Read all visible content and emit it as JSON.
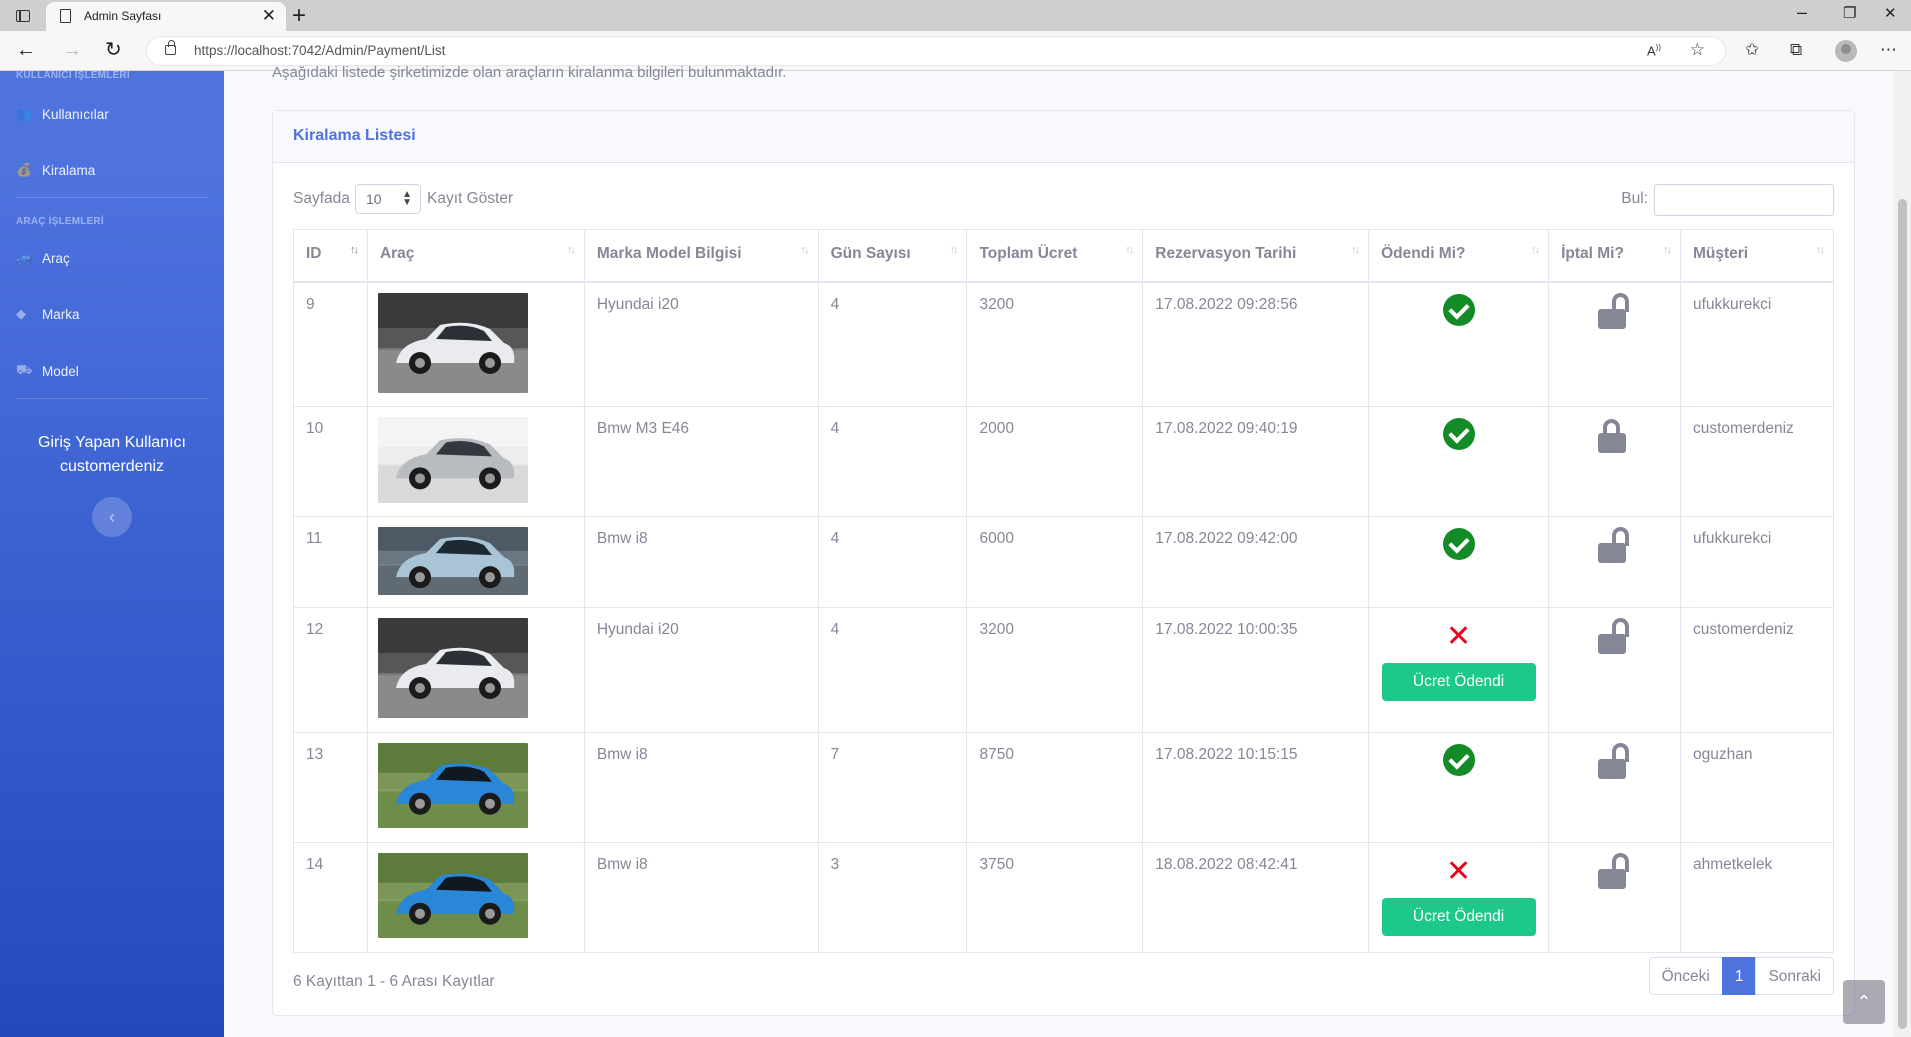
{
  "browser": {
    "tab_title": "Admin Sayfası",
    "url": "https://localhost:7042/Admin/Payment/List",
    "close_glyph": "✕",
    "newtab_glyph": "+"
  },
  "sidebar": {
    "heading_user": "KULLANICI İŞLEMLERİ",
    "heading_vehicle": "ARAÇ İŞLEMLERİ",
    "items": [
      {
        "label": "Kullanıcılar",
        "icon": "users-icon"
      },
      {
        "label": "Kiralama",
        "icon": "money-bag-icon"
      },
      {
        "label": "Araç",
        "icon": "car-icon"
      },
      {
        "label": "Marka",
        "icon": "diamond-icon"
      },
      {
        "label": "Model",
        "icon": "dolly-icon"
      }
    ],
    "user_line1": "Giriş Yapan Kullanıcı",
    "user_line2": "customerdeniz"
  },
  "intro_text": "Aşağıdaki listede şirketimizde olan araçların kiralanma bilgileri bulunmaktadır.",
  "card": {
    "title": "Kiralama Listesi",
    "length_prefix": "Sayfada",
    "length_value": "10",
    "length_suffix": "Kayıt Göster",
    "search_label": "Bul:",
    "columns": [
      "ID",
      "Araç",
      "Marka Model Bilgisi",
      "Gün Sayısı",
      "Toplam Ücret",
      "Rezervasyon Tarihi",
      "Ödendi Mi?",
      "İptal Mi?",
      "Müşteri"
    ],
    "rows": [
      {
        "id": "9",
        "car": "hyundai-white",
        "model": "Hyundai i20",
        "days": "4",
        "total": "3200",
        "date": "17.08.2022 09:28:56",
        "paid": true,
        "cancel_locked": false,
        "customer": "ufukkurekci"
      },
      {
        "id": "10",
        "car": "bmw-m3-silver",
        "model": "Bmw M3 E46",
        "days": "4",
        "total": "2000",
        "date": "17.08.2022 09:40:19",
        "paid": true,
        "cancel_locked": true,
        "customer": "customerdeniz"
      },
      {
        "id": "11",
        "car": "bmw-i8-silver",
        "model": "Bmw i8",
        "days": "4",
        "total": "6000",
        "date": "17.08.2022 09:42:00",
        "paid": true,
        "cancel_locked": false,
        "customer": "ufukkurekci"
      },
      {
        "id": "12",
        "car": "hyundai-white",
        "model": "Hyundai i20",
        "days": "4",
        "total": "3200",
        "date": "17.08.2022 10:00:35",
        "paid": false,
        "cancel_locked": false,
        "customer": "customerdeniz"
      },
      {
        "id": "13",
        "car": "bmw-i8-blue",
        "model": "Bmw i8",
        "days": "7",
        "total": "8750",
        "date": "17.08.2022 10:15:15",
        "paid": true,
        "cancel_locked": false,
        "customer": "oguzhan"
      },
      {
        "id": "14",
        "car": "bmw-i8-blue",
        "model": "Bmw i8",
        "days": "3",
        "total": "3750",
        "date": "18.08.2022 08:42:41",
        "paid": false,
        "cancel_locked": false,
        "customer": "ahmetkelek"
      }
    ],
    "pay_button_label": "Ücret Ödendi",
    "info": "6 Kayıttan 1 - 6 Arası Kayıtlar",
    "pager": {
      "prev": "Önceki",
      "current": "1",
      "next": "Sonraki"
    }
  },
  "colors": {
    "primary": "#4e73df",
    "success": "#1cc88a",
    "paid_icon": "#138c28",
    "unpaid_icon": "#e8001c"
  }
}
